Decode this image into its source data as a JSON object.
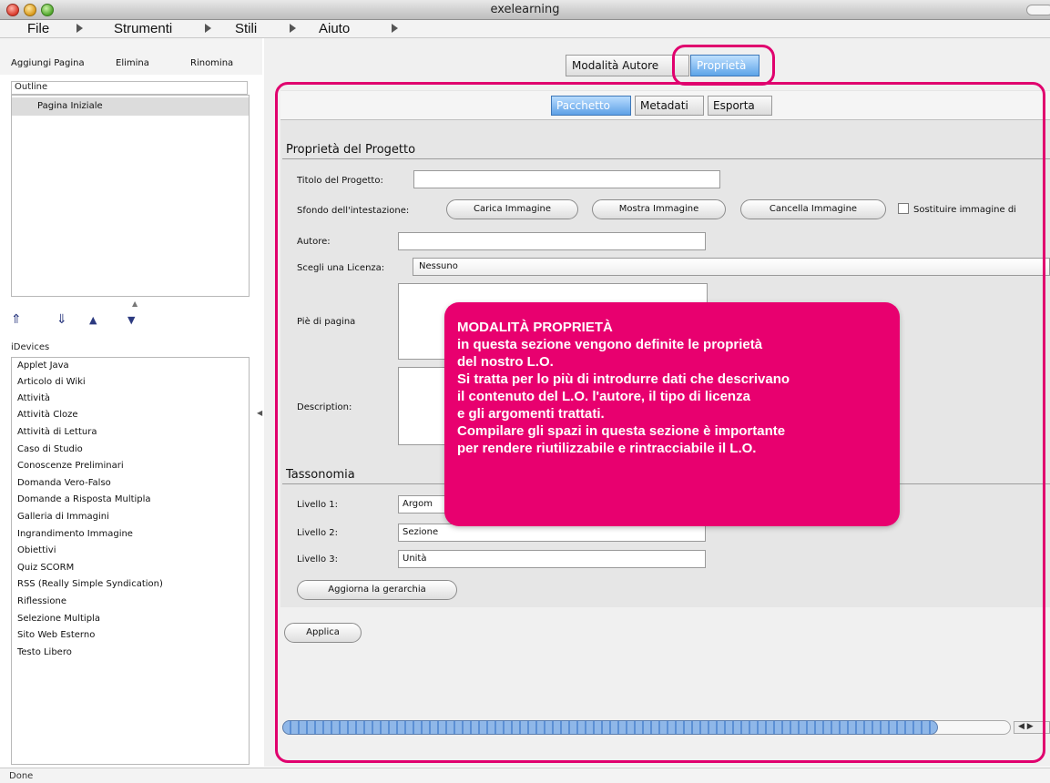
{
  "window": {
    "title": "exelearning"
  },
  "menubar": {
    "items": [
      "File",
      "Strumenti",
      "Stili",
      "Aiuto"
    ]
  },
  "left_toolbar": {
    "add_page": "Aggiungi Pagina",
    "delete": "Elimina",
    "rename": "Rinomina"
  },
  "outline": {
    "header": "Outline",
    "selected_item": "Pagina Iniziale"
  },
  "idevices": {
    "label": "iDevices",
    "items": [
      "Applet Java",
      "Articolo di Wiki",
      "Attività",
      "Attività Cloze",
      "Attività di Lettura",
      "Caso di Studio",
      "Conoscenze Preliminari",
      "Domanda Vero-Falso",
      "Domande a Risposta Multipla",
      "Galleria di Immagini",
      "Ingrandimento Immagine",
      "Obiettivi",
      "Quiz SCORM",
      "RSS (Really Simple Syndication)",
      "Riflessione",
      "Selezione Multipla",
      "Sito Web Esterno",
      "Testo Libero"
    ]
  },
  "mode_tabs": {
    "authoring": "Modalità Autore",
    "properties": "Proprietà"
  },
  "sub_tabs": {
    "package": "Pacchetto",
    "metadata": "Metadati",
    "export": "Esporta"
  },
  "project": {
    "section_title": "Proprietà del Progetto",
    "title_label": "Titolo del Progetto:",
    "title_value": "",
    "header_bg_label": "Sfondo dell'intestazione:",
    "load_image": "Carica Immagine",
    "show_image": "Mostra Immagine",
    "delete_image": "Cancella Immagine",
    "replace_image_label": "Sostituire immagine di",
    "author_label": "Autore:",
    "author_value": "",
    "license_label": "Scegli una Licenza:",
    "license_value": "Nessuno",
    "footer_label": "Piè di pagina",
    "description_label": "Description:"
  },
  "taxonomy": {
    "section_title": "Tassonomia",
    "level1_label": "Livello 1:",
    "level1_value": "Argom",
    "level2_label": "Livello 2:",
    "level2_value": "Sezione",
    "level3_label": "Livello 3:",
    "level3_value": "Unità",
    "update_button": "Aggiorna la gerarchia"
  },
  "apply_button": "Applica",
  "callout": {
    "title": "MODALITÀ PROPRIETÀ",
    "lines": [
      "in questa sezione vengono definite le proprietà",
      "del nostro L.O.",
      "Si tratta per lo più di introdurre dati che descrivano",
      "il contenuto del L.O. l'autore, il tipo di licenza",
      "e gli argomenti trattati.",
      "Compilare gli spazi in questa sezione è importante",
      "per rendere riutilizzabile e rintracciabile il L.O."
    ]
  },
  "status": {
    "text": "Done"
  },
  "colors": {
    "highlight": "#e0006e",
    "callout_bg": "#e8006f",
    "active_tab": "#5ea4e8"
  },
  "icons": [
    "up-arrow-icon",
    "down-arrow-icon",
    "move-up-icon",
    "move-down-icon"
  ]
}
